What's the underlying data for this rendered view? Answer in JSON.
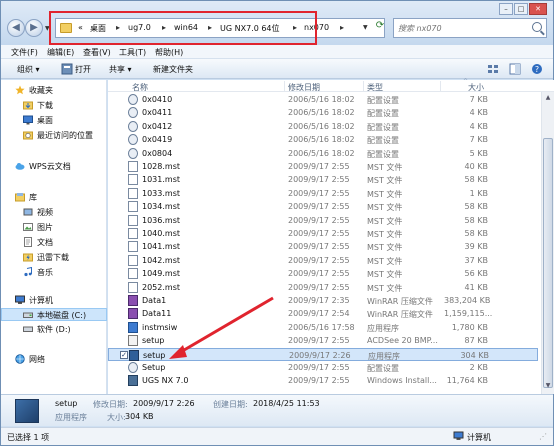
{
  "window": {
    "controls": {
      "minimize": "–",
      "maximize": "□",
      "close": "✕"
    }
  },
  "address": {
    "overflow": "«",
    "segments": [
      "桌面",
      "ug7.0",
      "win64",
      "UG NX7.0 64位",
      "nx070"
    ],
    "separator": "▸"
  },
  "search": {
    "placeholder": "搜索 nx070"
  },
  "menu": [
    "文件(F)",
    "编辑(E)",
    "查看(V)",
    "工具(T)",
    "帮助(H)"
  ],
  "toolbar": {
    "organize": "组织 ▾",
    "open": "打开",
    "share": "共享 ▾",
    "new_folder": "新建文件夹"
  },
  "nav": {
    "favorites": "收藏夹",
    "downloads": "下载",
    "desktop": "桌面",
    "recent": "最近访问的位置",
    "wps": "WPS云文档",
    "libraries": "库",
    "videos": "视频",
    "pictures": "图片",
    "documents": "文档",
    "thunder": "迅雷下载",
    "music": "音乐",
    "computer": "计算机",
    "local_c": "本地磁盘 (C:)",
    "soft_d": "软件 (D:)",
    "network": "网络"
  },
  "columns": {
    "name": "名称",
    "date": "修改日期",
    "type": "类型",
    "size": "大小"
  },
  "files": [
    {
      "name": "0x0410",
      "date": "2006/5/16 18:02",
      "type": "配置设置",
      "size": "7 KB",
      "icon": "config-icon"
    },
    {
      "name": "0x0411",
      "date": "2006/5/16 18:02",
      "type": "配置设置",
      "size": "4 KB",
      "icon": "config-icon"
    },
    {
      "name": "0x0412",
      "date": "2006/5/16 18:02",
      "type": "配置设置",
      "size": "4 KB",
      "icon": "config-icon"
    },
    {
      "name": "0x0419",
      "date": "2006/5/16 18:02",
      "type": "配置设置",
      "size": "7 KB",
      "icon": "config-icon"
    },
    {
      "name": "0x0804",
      "date": "2006/5/16 18:02",
      "type": "配置设置",
      "size": "5 KB",
      "icon": "config-icon"
    },
    {
      "name": "1028.mst",
      "date": "2009/9/17 2:55",
      "type": "MST 文件",
      "size": "40 KB",
      "icon": "document-icon"
    },
    {
      "name": "1031.mst",
      "date": "2009/9/17 2:55",
      "type": "MST 文件",
      "size": "58 KB",
      "icon": "document-icon"
    },
    {
      "name": "1033.mst",
      "date": "2009/9/17 2:55",
      "type": "MST 文件",
      "size": "1 KB",
      "icon": "document-icon"
    },
    {
      "name": "1034.mst",
      "date": "2009/9/17 2:55",
      "type": "MST 文件",
      "size": "58 KB",
      "icon": "document-icon"
    },
    {
      "name": "1036.mst",
      "date": "2009/9/17 2:55",
      "type": "MST 文件",
      "size": "58 KB",
      "icon": "document-icon"
    },
    {
      "name": "1040.mst",
      "date": "2009/9/17 2:55",
      "type": "MST 文件",
      "size": "58 KB",
      "icon": "document-icon"
    },
    {
      "name": "1041.mst",
      "date": "2009/9/17 2:55",
      "type": "MST 文件",
      "size": "39 KB",
      "icon": "document-icon"
    },
    {
      "name": "1042.mst",
      "date": "2009/9/17 2:55",
      "type": "MST 文件",
      "size": "37 KB",
      "icon": "document-icon"
    },
    {
      "name": "1049.mst",
      "date": "2009/9/17 2:55",
      "type": "MST 文件",
      "size": "56 KB",
      "icon": "document-icon"
    },
    {
      "name": "2052.mst",
      "date": "2009/9/17 2:55",
      "type": "MST 文件",
      "size": "41 KB",
      "icon": "document-icon"
    },
    {
      "name": "Data1",
      "date": "2009/9/17 2:35",
      "type": "WinRAR 压缩文件",
      "size": "383,204 KB",
      "icon": "archive-icon"
    },
    {
      "name": "Data11",
      "date": "2009/9/17 2:54",
      "type": "WinRAR 压缩文件",
      "size": "1,159,115...",
      "icon": "archive-icon"
    },
    {
      "name": "instmsiw",
      "date": "2006/5/16 17:58",
      "type": "应用程序",
      "size": "1,780 KB",
      "icon": "installer-icon"
    },
    {
      "name": "setup",
      "date": "2009/9/17 2:55",
      "type": "ACDSee 20 BMP...",
      "size": "87 KB",
      "icon": "image-icon"
    },
    {
      "name": "setup",
      "date": "2009/9/17 2:26",
      "type": "应用程序",
      "size": "304 KB",
      "icon": "setup-app-icon"
    },
    {
      "name": "Setup",
      "date": "2009/9/17 2:55",
      "type": "配置设置",
      "size": "2 KB",
      "icon": "config-icon"
    },
    {
      "name": "UGS NX 7.0",
      "date": "2009/9/17 2:55",
      "type": "Windows Install...",
      "size": "11,764 KB",
      "icon": "msi-icon"
    }
  ],
  "selected_index": 19,
  "details": {
    "name": "setup",
    "modified_label": "修改日期:",
    "modified": "2009/9/17 2:26",
    "created_label": "创建日期:",
    "created": "2018/4/25 11:53",
    "kind": "应用程序",
    "size_label": "大小:",
    "size": "304 KB"
  },
  "status": {
    "selected": "已选择 1 项",
    "location": "计算机"
  },
  "colors": {
    "highlight": "#e0242e",
    "selection": "#d3e6fa"
  }
}
